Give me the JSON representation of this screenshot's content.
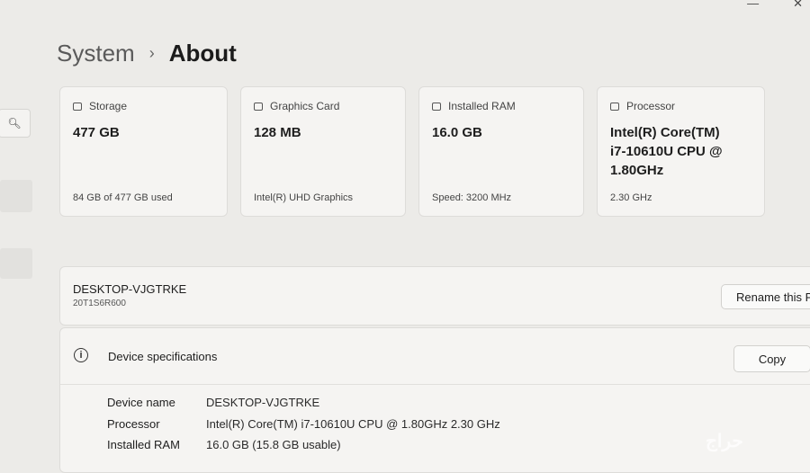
{
  "breadcrumb": {
    "parent": "System",
    "separator": "›",
    "current": "About"
  },
  "cards": [
    {
      "icon": "storage-icon",
      "label": "Storage",
      "value": "477 GB",
      "sub": "84 GB of 477 GB used"
    },
    {
      "icon": "graphics-card-icon",
      "label": "Graphics Card",
      "value": "128 MB",
      "sub": "Intel(R) UHD Graphics"
    },
    {
      "icon": "ram-icon",
      "label": "Installed RAM",
      "value": "16.0 GB",
      "sub": "Speed: 3200 MHz"
    },
    {
      "icon": "processor-icon",
      "label": "Processor",
      "value": "Intel(R) Core(TM) i7-10610U CPU @ 1.80GHz",
      "sub": "2.30 GHz"
    }
  ],
  "device": {
    "name": "DESKTOP-VJGTRKE",
    "model": "20T1S6R600",
    "rename_label": "Rename this P"
  },
  "specs": {
    "title": "Device specifications",
    "copy_label": "Copy",
    "rows": [
      {
        "label": "Device name",
        "value": "DESKTOP-VJGTRKE"
      },
      {
        "label": "Processor",
        "value": "Intel(R) Core(TM) i7-10610U CPU @ 1.80GHz   2.30 GHz"
      },
      {
        "label": "Installed RAM",
        "value": "16.0 GB (15.8 GB usable)"
      }
    ]
  },
  "watermark": "حراج"
}
